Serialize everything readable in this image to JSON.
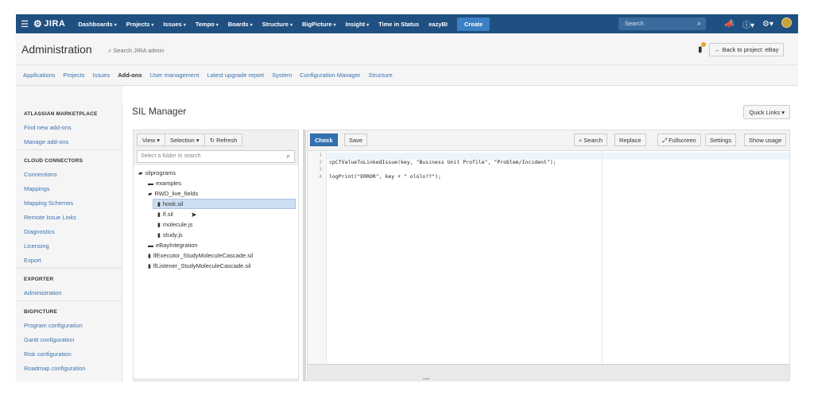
{
  "navbar": {
    "logo": "JIRA",
    "items": [
      {
        "label": "Dashboards",
        "caret": true
      },
      {
        "label": "Projects",
        "caret": true
      },
      {
        "label": "Issues",
        "caret": true
      },
      {
        "label": "Tempo",
        "caret": true
      },
      {
        "label": "Boards",
        "caret": true
      },
      {
        "label": "Structure",
        "caret": true
      },
      {
        "label": "BigPicture",
        "caret": true
      },
      {
        "label": "Insight",
        "caret": true
      },
      {
        "label": "Time in Status",
        "caret": false
      },
      {
        "label": "eazyBI",
        "caret": false
      }
    ],
    "create_label": "Create",
    "search_placeholder": "Search",
    "caret_glyph": "▾"
  },
  "admin": {
    "title": "Administration",
    "search_label": "Search JIRA admin",
    "back_label": "Back to project: eBay",
    "tabs": [
      {
        "label": "Applications",
        "active": false
      },
      {
        "label": "Projects",
        "active": false
      },
      {
        "label": "Issues",
        "active": false
      },
      {
        "label": "Add-ons",
        "active": true
      },
      {
        "label": "User management",
        "active": false
      },
      {
        "label": "Latest upgrade report",
        "active": false
      },
      {
        "label": "System",
        "active": false
      },
      {
        "label": "Configuration Manager",
        "active": false
      },
      {
        "label": "Structure",
        "active": false
      }
    ]
  },
  "sidebar": {
    "sections": [
      {
        "heading": "ATLASSIAN MARKETPLACE",
        "items": [
          "Find new add-ons",
          "Manage add-ons"
        ]
      },
      {
        "heading": "CLOUD CONNECTORS",
        "items": [
          "Connections",
          "Mappings",
          "Mapping Schemes",
          "Remote Issue Links",
          "Diagnostics",
          "Licensing",
          "Export"
        ]
      },
      {
        "heading": "EXPORTER",
        "items": [
          "Administration"
        ]
      },
      {
        "heading": "BIGPICTURE",
        "items": [
          "Program configuration",
          "Gantt configuration",
          "Risk configuration",
          "Roadmap configuration"
        ]
      }
    ]
  },
  "main": {
    "title": "SIL Manager",
    "quick_links_label": "Quick Links"
  },
  "tree": {
    "view_label": "View",
    "selection_label": "Selection",
    "refresh_label": "Refresh",
    "search_placeholder": "Select a folder to search",
    "nodes": [
      {
        "label": "silprograms",
        "type": "folder-open",
        "depth": 0
      },
      {
        "label": "examples",
        "type": "folder",
        "depth": 1
      },
      {
        "label": "RWD_live_fields",
        "type": "folder-open",
        "depth": 1
      },
      {
        "label": "hook.sil",
        "type": "file",
        "depth": 2,
        "selected": true
      },
      {
        "label": "lf.sil",
        "type": "file",
        "depth": 2
      },
      {
        "label": "molecule.js",
        "type": "file",
        "depth": 2
      },
      {
        "label": "study.js",
        "type": "file",
        "depth": 2
      },
      {
        "label": "eBayIntegration",
        "type": "folder",
        "depth": 1
      },
      {
        "label": "lfExecutor_StudyMoleculeCascade.sil",
        "type": "file",
        "depth": 1
      },
      {
        "label": "lfListener_StudyMoleculeCascade.sil",
        "type": "file",
        "depth": 1
      }
    ]
  },
  "editor": {
    "check_label": "Check",
    "save_label": "Save",
    "search_label": "Search",
    "replace_label": "Replace",
    "fullscreen_label": "Fullscreen",
    "settings_label": "Settings",
    "show_usage_label": "Show usage",
    "lines": [
      {
        "no": "1",
        "code": ""
      },
      {
        "no": "2",
        "code": "cpCfValueToLinkedIssue(key, \"Business Unit Profile\", \"Problem/Incident\");"
      },
      {
        "no": "3",
        "code": ""
      },
      {
        "no": "4",
        "code": "logPrint(\"ERROR\", key + \" ololo??\");"
      }
    ]
  }
}
